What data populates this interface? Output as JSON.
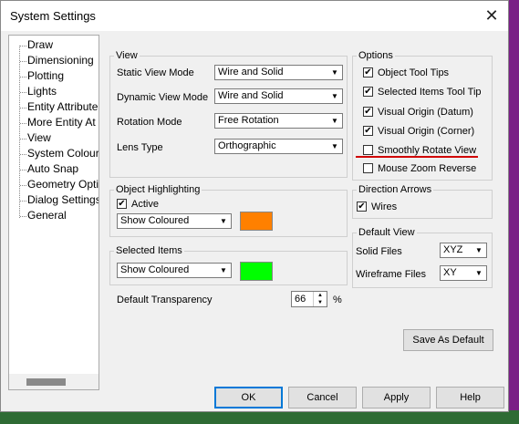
{
  "window": {
    "title": "System Settings",
    "close_icon": "close-icon"
  },
  "tree": {
    "items": [
      "Draw",
      "Dimensioning",
      "Plotting",
      "Lights",
      "Entity Attribute",
      "More Entity At",
      "View",
      "System Colour",
      "Auto Snap",
      "Geometry Opti",
      "Dialog Settings",
      "General"
    ]
  },
  "view": {
    "legend": "View",
    "static_view_mode_label": "Static View Mode",
    "static_view_mode_value": "Wire and Solid",
    "dynamic_view_mode_label": "Dynamic View Mode",
    "dynamic_view_mode_value": "Wire and Solid",
    "rotation_mode_label": "Rotation Mode",
    "rotation_mode_value": "Free Rotation",
    "lens_type_label": "Lens Type",
    "lens_type_value": "Orthographic"
  },
  "options": {
    "legend": "Options",
    "items": [
      {
        "label": "Object Tool Tips",
        "checked": true
      },
      {
        "label": "Selected Items Tool Tip",
        "checked": true
      },
      {
        "label": "Visual Origin (Datum)",
        "checked": true
      },
      {
        "label": "Visual Origin (Corner)",
        "checked": true
      },
      {
        "label": "Smoothly Rotate View",
        "checked": false
      },
      {
        "label": "Mouse Zoom Reverse",
        "checked": false
      }
    ]
  },
  "object_highlighting": {
    "legend": "Object Highlighting",
    "active_label": "Active",
    "active_checked": true,
    "mode_value": "Show Coloured",
    "color": "#ff8000"
  },
  "direction_arrows": {
    "legend": "Direction Arrows",
    "wires_label": "Wires",
    "wires_checked": true
  },
  "selected_items": {
    "legend": "Selected Items",
    "mode_value": "Show Coloured",
    "color": "#00ff00"
  },
  "default_view": {
    "legend": "Default View",
    "solid_files_label": "Solid Files",
    "solid_files_value": "XYZ",
    "wireframe_files_label": "Wireframe Files",
    "wireframe_files_value": "XY"
  },
  "transparency": {
    "label": "Default Transparency",
    "value": "66",
    "unit": "%"
  },
  "buttons": {
    "save_as_default": "Save As Default",
    "ok": "OK",
    "cancel": "Cancel",
    "apply": "Apply",
    "help": "Help"
  },
  "check_mark": "✔"
}
